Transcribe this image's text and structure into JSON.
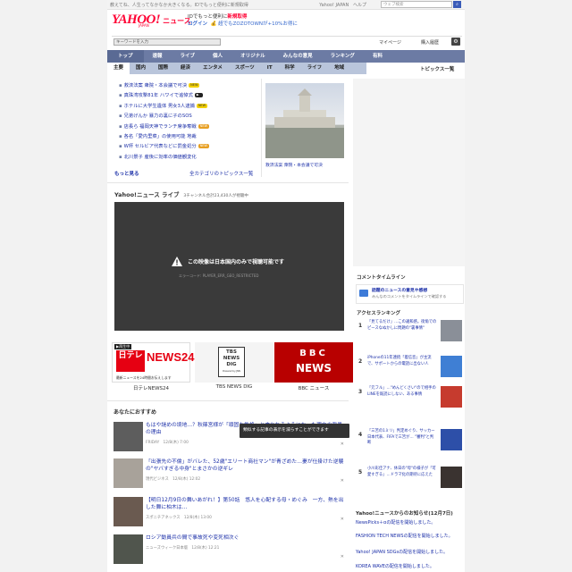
{
  "topbar": {
    "message": "教えてね、人生ってなかなか大きくなる。IDでもっと便利に新規取得",
    "links": [
      "Yahoo! JAPAN",
      "ヘルプ"
    ],
    "search_placeholder": "ウェブ検索"
  },
  "logo": {
    "brand": "YAHOO!",
    "sub": "JAPAN",
    "section": "ニュース"
  },
  "promo": {
    "line1_prefix": "IDでもっと便利に",
    "line1_link": "新規取得",
    "line2_link": "ログイン",
    "line2_text": "️ 💰 超でもZOZOTOWNが+10%お得に"
  },
  "subbar": {
    "search_placeholder": "キーワードを入力",
    "mypage": "マイページ",
    "purchase": "購入履歴"
  },
  "nav_main": [
    "トップ",
    "速報",
    "ライブ",
    "個人",
    "オリジナル",
    "みんなの意見",
    "ランキング",
    "有料"
  ],
  "nav_sub": [
    "主要",
    "国内",
    "国際",
    "経済",
    "エンタメ",
    "スポーツ",
    "IT",
    "科学",
    "ライフ",
    "地域"
  ],
  "topics_link": "トピックス一覧",
  "topics": [
    {
      "text": "救済法案 衆院・本会議で可決",
      "badge": "new"
    },
    {
      "text": "真珠湾攻撃81年 ハワイで追悼式",
      "badge": "vid"
    },
    {
      "text": "ホテルに大学生遺体 男女3人逮捕",
      "badge": "new"
    },
    {
      "text": "兄弟げんか 暴力の裏に子のSOS",
      "badge": ""
    },
    {
      "text": "店長ら 福岡天神でランチ席争奪戦",
      "badge": "up"
    },
    {
      "text": "各名「愛内里菜」の使用可能 地裁",
      "badge": ""
    },
    {
      "text": "W杯 セルビア代表などに罰金処分",
      "badge": "up"
    },
    {
      "text": "北川景子 産後に効率の価値観変化",
      "badge": ""
    }
  ],
  "topics_badges": {
    "new": "NEW",
    "up": "NEW",
    "vid": "▶"
  },
  "more_label": "もっと見る",
  "all_topics_label": "全カテゴリのトピックス一覧",
  "photo_caption": "救済法案 衆院・本会議で可決",
  "live": {
    "title": "Yahoo!ニュース ライブ",
    "sub": "3チャンネル合計23,430人が視聴中",
    "message": "この映像は日本国内のみで視聴可能です",
    "code": "エラーコード: PLAYER_ERR_GEO_RESTRICTED"
  },
  "channels": [
    {
      "name": "日テレNEWS24",
      "badge": "▶再生中",
      "line1": "日テレ",
      "line2": "NEWS24",
      "caption": "最新ニュースを24時間お伝えします"
    },
    {
      "name": "TBS NEWS DIG",
      "line1": "TBS",
      "line2": "NEWS",
      "line3": "DIG",
      "caption": "Powered by JNN"
    },
    {
      "name": "BBC ニュース",
      "line1": "BBC",
      "line2": "NEWS"
    }
  ],
  "recommend_title": "あなたにおすすめ",
  "articles": [
    {
      "title": "もはや謎めの境地…？秋篠宮様が「頑固な性格」と言われるようになった理由の背景の理由",
      "source": "FRIDAY　12/8(木) 7:00"
    },
    {
      "title": "「出張先の不倫」がバレた、52歳\"エリート商社マン\"が青ざめた…妻が仕掛けた逆襲の\"ヤバすぎる中身\"とまさかの逆ギレ",
      "source": "現代ビジネス　12/8(木) 12:02"
    },
    {
      "title": "【明日12月9日の舞いあがれ！】第50話　悠人を心配する母・めぐみ　一方、熱を出した舞に柏木は…",
      "source": "スポニチアネックス　12/8(木) 13:00"
    },
    {
      "title": "ロシア動員兵の間で事故死や変死相次ぐ",
      "source": "ニューズウィーク日本版　12/8(木) 12:21"
    }
  ],
  "tooltip": "類似する記事の表示を減らすことができます",
  "comment_timeline": {
    "title": "コメントタイムライン",
    "link": "話題のニュースの意見や感想",
    "desc": "みんなのコメントをタイムラインで確認する"
  },
  "ranking": {
    "title": "アクセスランキング",
    "items": [
      {
        "n": "1",
        "t": "「見てるだけ」…この違和感。街角でのピースなぬかしに問題の\"裏事情\""
      },
      {
        "n": "2",
        "t": "iPhoneの11年連続「着信音」が主流で、サポートからの電話に出ない人"
      },
      {
        "n": "3",
        "t": "「元フル」…\"めんどくさい\"ので相手のLINEを既読にしない、ある事情"
      },
      {
        "n": "4",
        "t": "「三笘の1ミリ」判定めぐり、サッカー日本代表、FIFAで三笘が… \"審判\"と判断"
      },
      {
        "n": "5",
        "t": "小川彩佳アナ、休日の\"母\"の様子が「可愛すぎる」…ドラマ化の期待に応えた"
      }
    ]
  },
  "notices": {
    "title": "Yahoo!ニュースからのお知らせ(12月7日)",
    "items": [
      "NewsPicks＋αの配信を開始しました。",
      "FASHION TECH NEWSの配信を開始しました。",
      "Yahoo! JAPAN SDGsの配信を開始しました。",
      "KOREA WAVEの配信を開始しました。"
    ]
  },
  "colors": {
    "brand": "#ff0033",
    "nav": "#6c7ba4",
    "link": "#1b2fa8"
  }
}
